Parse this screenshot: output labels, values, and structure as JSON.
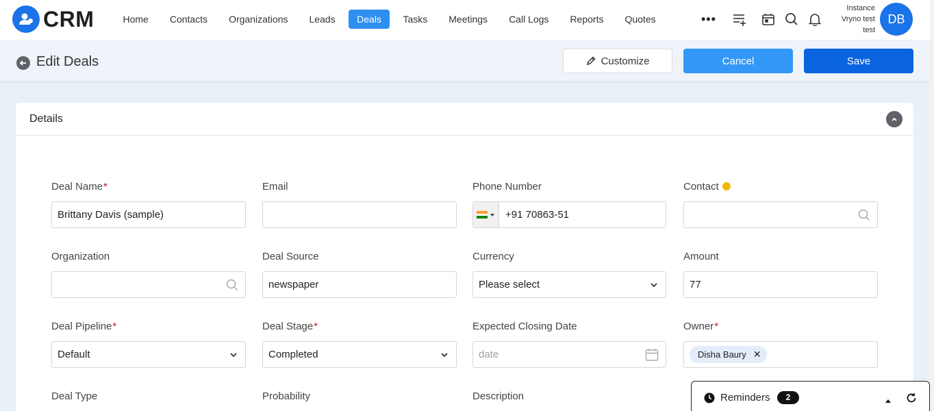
{
  "app": {
    "logo_text": "CRM"
  },
  "nav": {
    "items": [
      "Home",
      "Contacts",
      "Organizations",
      "Leads",
      "Deals",
      "Tasks",
      "Meetings",
      "Call Logs",
      "Reports",
      "Quotes"
    ],
    "active": "Deals",
    "more": "•••"
  },
  "user": {
    "instance_line1": "Instance",
    "instance_line2": "Vryno test",
    "instance_line3": "test",
    "initials": "DB"
  },
  "header": {
    "title": "Edit Deals",
    "customize_label": "Customize",
    "cancel_label": "Cancel",
    "save_label": "Save"
  },
  "section": {
    "title": "Details"
  },
  "fields": {
    "deal_name": {
      "label": "Deal Name",
      "required": "*",
      "value": "Brittany Davis (sample)"
    },
    "email": {
      "label": "Email",
      "value": ""
    },
    "phone": {
      "label": "Phone Number",
      "value": "+91 70863-51"
    },
    "contact": {
      "label": "Contact",
      "value": ""
    },
    "organization": {
      "label": "Organization",
      "value": ""
    },
    "deal_source": {
      "label": "Deal Source",
      "value": "newspaper"
    },
    "currency": {
      "label": "Currency",
      "value": "Please select"
    },
    "amount": {
      "label": "Amount",
      "value": "77"
    },
    "deal_pipeline": {
      "label": "Deal Pipeline",
      "required": "*",
      "value": "Default"
    },
    "deal_stage": {
      "label": "Deal Stage",
      "required": "*",
      "value": "Completed"
    },
    "expected_closing_date": {
      "label": "Expected Closing Date",
      "placeholder": "date"
    },
    "owner": {
      "label": "Owner",
      "required": "*",
      "chip": "Disha Baury"
    },
    "deal_type": {
      "label": "Deal Type"
    },
    "probability": {
      "label": "Probability"
    },
    "description": {
      "label": "Description"
    }
  },
  "reminders": {
    "label": "Reminders",
    "count": "2"
  },
  "colors": {
    "primary": "#0a64e0",
    "accent": "#3398f7",
    "nav_active": "#2d8ff0",
    "required": "#c0171d"
  }
}
